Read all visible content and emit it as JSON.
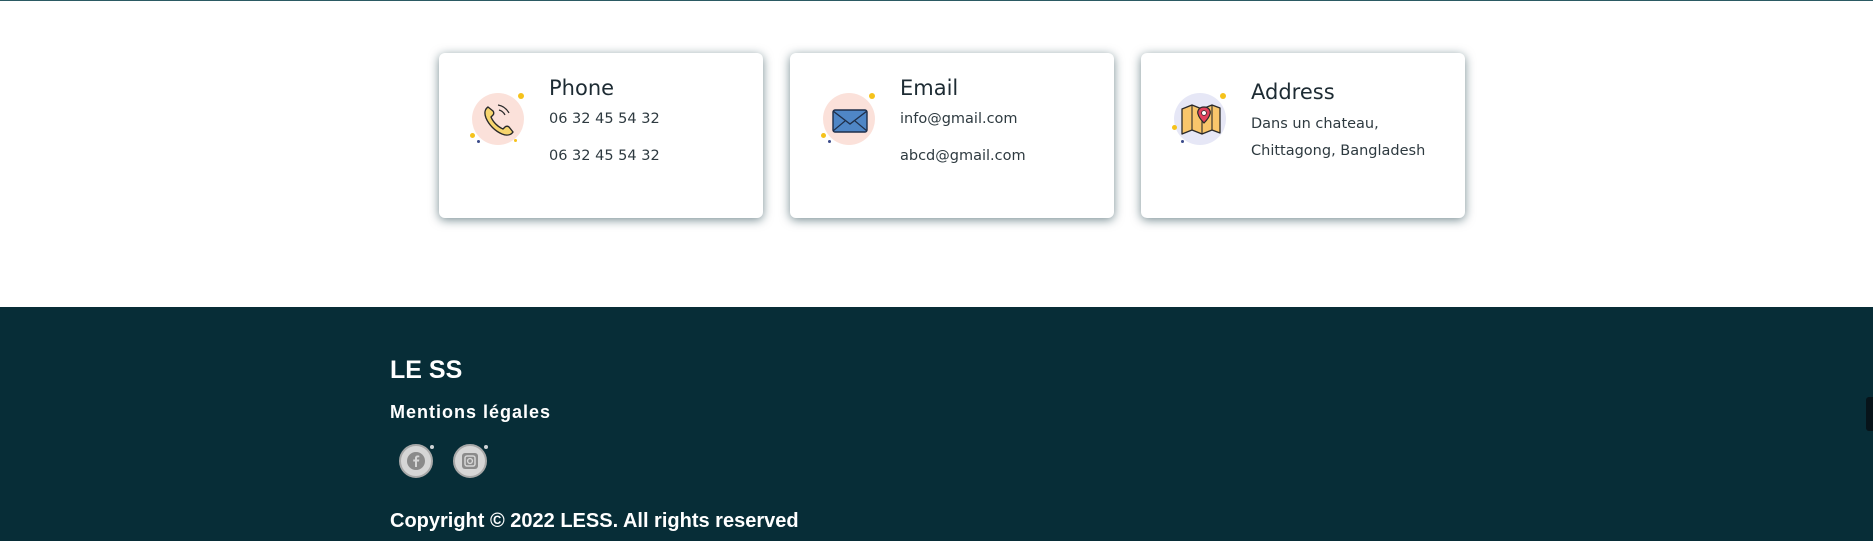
{
  "contact": {
    "phone": {
      "title": "Phone",
      "icon": "phone-icon",
      "lines": [
        "06 32 45 54 32",
        "06 32 45 54 32"
      ]
    },
    "email": {
      "title": "Email",
      "icon": "envelope-icon",
      "lines": [
        "info@gmail.com",
        "abcd@gmail.com"
      ]
    },
    "address": {
      "title": "Address",
      "icon": "map-pin-icon",
      "lines": [
        "Dans un chateau,",
        "Chittagong, Bangladesh"
      ]
    }
  },
  "footer": {
    "brand": "LE SS",
    "legal_link": "Mentions légales",
    "social": [
      "facebook-icon",
      "instagram-icon"
    ],
    "copyright": "Copyright © 2022 LESS. All rights reserved"
  },
  "colors": {
    "footer_bg": "#072d37",
    "card_shadow": "#072e38",
    "icon_bg_pink": "#fbe1da",
    "icon_bg_lavender": "#e6e7f6",
    "accent_yellow": "#f5c21b"
  }
}
